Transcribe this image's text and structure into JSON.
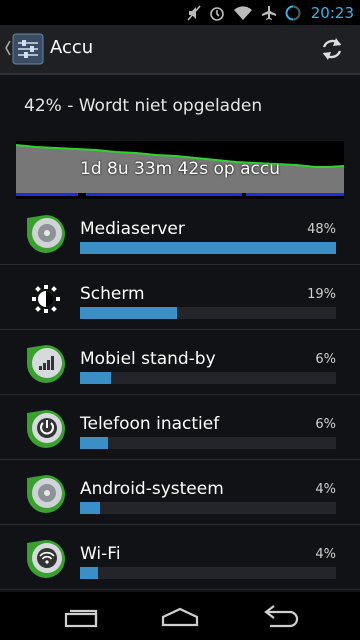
{
  "status_bar": {
    "time": "20:23",
    "icons": [
      "mute-icon",
      "alarm-icon",
      "wifi-icon",
      "airplane-icon",
      "battery-icon"
    ],
    "accent": "#33b5e5"
  },
  "action_bar": {
    "title": "Accu",
    "refresh_icon": "refresh-icon"
  },
  "battery": {
    "status": "42% - Wordt niet opgeladen",
    "graph_label": "1d 8u 33m 42s op accu"
  },
  "usage": [
    {
      "name": "Mediaserver",
      "percent_label": "48%",
      "fraction": 1.0,
      "icon": "mediaserver-icon"
    },
    {
      "name": "Scherm",
      "percent_label": "19%",
      "fraction": 0.38,
      "icon": "screen-brightness-icon"
    },
    {
      "name": "Mobiel stand-by",
      "percent_label": "6%",
      "fraction": 0.12,
      "icon": "cell-standby-icon"
    },
    {
      "name": "Telefoon inactief",
      "percent_label": "6%",
      "fraction": 0.11,
      "icon": "power-icon"
    },
    {
      "name": "Android-systeem",
      "percent_label": "4%",
      "fraction": 0.08,
      "icon": "android-system-icon"
    },
    {
      "name": "Wi-Fi",
      "percent_label": "4%",
      "fraction": 0.07,
      "icon": "wifi-icon"
    }
  ],
  "nav": {
    "back": "back-icon",
    "home": "home-icon",
    "recents": "recents-icon"
  },
  "colors": {
    "bar_fill": "#3a8fc7",
    "graph_fill": "#777777",
    "graph_line": "#2fd32f",
    "graph_blue": "#1e2fd6"
  }
}
